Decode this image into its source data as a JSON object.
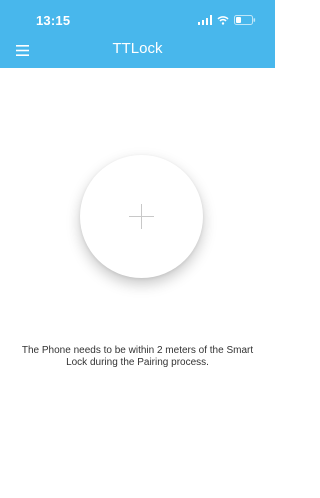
{
  "status_bar": {
    "time": "13:15",
    "icons": [
      "signal-icon",
      "wifi-icon",
      "battery-icon"
    ]
  },
  "app": {
    "title": "TTLock",
    "menu_icon": "hamburger-menu-icon",
    "add_icon": "plus-icon"
  },
  "main": {
    "instruction_line1": "The Phone needs to be within 2 meters of the Smart",
    "instruction_line2": "Lock during the Pairing process."
  },
  "colors": {
    "header_background": "#48b7ec",
    "header_text": "#ffffff",
    "page_background": "#ffffff",
    "body_text": "#333333",
    "plus_icon": "#c8c8c8"
  }
}
